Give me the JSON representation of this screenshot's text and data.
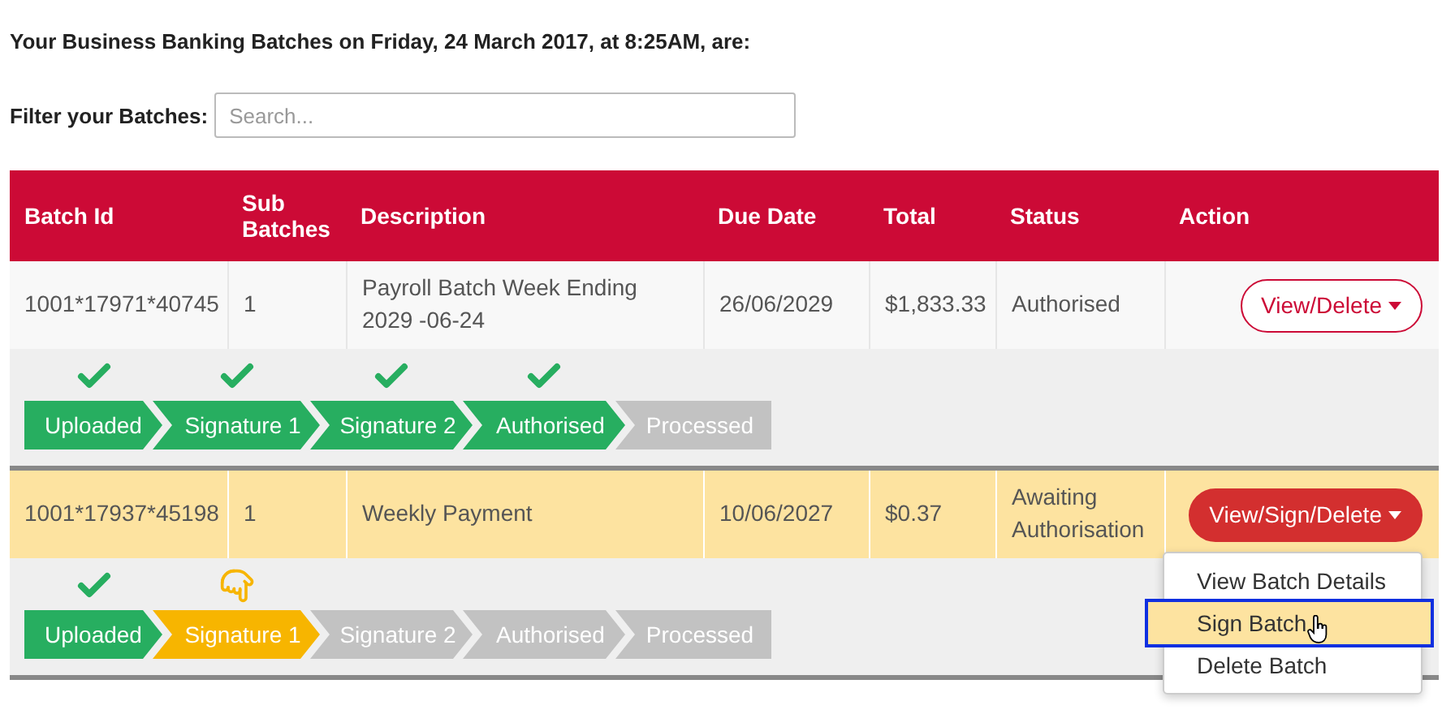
{
  "heading": "Your Business Banking Batches on Friday, 24 March 2017, at 8:25AM, are:",
  "filter": {
    "label": "Filter your Batches:",
    "placeholder": "Search..."
  },
  "table": {
    "columns": [
      "Batch Id",
      "Sub Batches",
      "Description",
      "Due Date",
      "Total",
      "Status",
      "Action"
    ],
    "rows": [
      {
        "batch_id": "1001*17971*40745",
        "sub_batches": "1",
        "description": "Payroll Batch Week Ending 2029 -06-24",
        "due_date": "26/06/2029",
        "total": "$1,833.33",
        "status": "Authorised",
        "action": {
          "label": "View/Delete",
          "kind": "outline"
        },
        "highlighted": false,
        "steps": [
          {
            "label": "Uploaded",
            "kind": "done"
          },
          {
            "label": "Signature 1",
            "kind": "done"
          },
          {
            "label": "Signature 2",
            "kind": "done"
          },
          {
            "label": "Authorised",
            "kind": "done"
          },
          {
            "label": "Processed",
            "kind": "pending"
          }
        ]
      },
      {
        "batch_id": "1001*17937*45198",
        "sub_batches": "1",
        "description": "Weekly Payment",
        "due_date": "10/06/2027",
        "total": "$0.37",
        "status": "Awaiting Authorisation",
        "action": {
          "label": "View/Sign/Delete",
          "kind": "filled"
        },
        "highlighted": true,
        "steps": [
          {
            "label": "Uploaded",
            "kind": "done"
          },
          {
            "label": "Signature 1",
            "kind": "current"
          },
          {
            "label": "Signature 2",
            "kind": "pending"
          },
          {
            "label": "Authorised",
            "kind": "pending"
          },
          {
            "label": "Processed",
            "kind": "pending"
          }
        ],
        "menu": [
          {
            "label": "View Batch Details",
            "selected": false
          },
          {
            "label": "Sign Batch",
            "selected": true
          },
          {
            "label": "Delete Batch",
            "selected": false
          }
        ]
      }
    ]
  }
}
